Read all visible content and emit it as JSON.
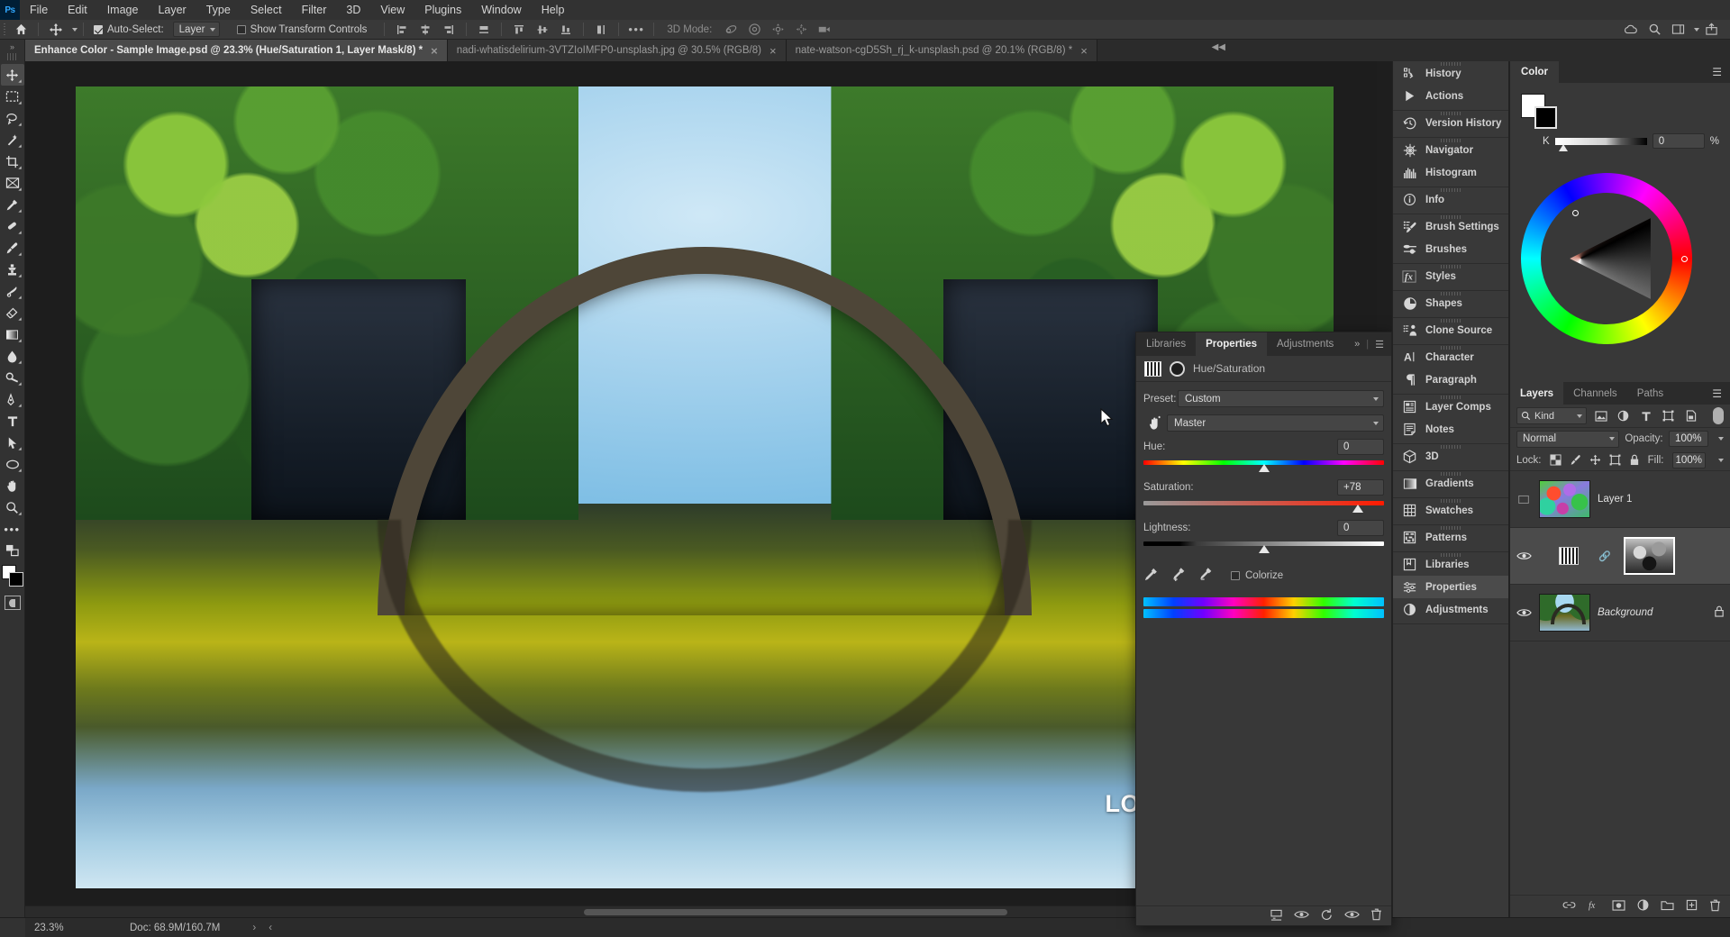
{
  "app": {
    "name": "Adobe Photoshop",
    "logo_text": "Ps",
    "accent": "#31a8ff",
    "panel_bg": "#383838",
    "chrome_bg": "#323232"
  },
  "menubar": {
    "items": [
      "File",
      "Edit",
      "Image",
      "Layer",
      "Type",
      "Select",
      "Filter",
      "3D",
      "View",
      "Plugins",
      "Window",
      "Help"
    ]
  },
  "options_bar": {
    "home_icon": "home-icon",
    "tool_icon": "move-tool-icon",
    "auto_select_label": "Auto-Select:",
    "auto_select_checked": true,
    "auto_select_value": "Layer",
    "show_transform_label": "Show Transform Controls",
    "show_transform_checked": false,
    "align_icons": [
      "align-left-edges-icon",
      "align-horizontal-centers-icon",
      "align-right-edges-icon",
      "distribute-horizontal-icon",
      "align-top-edges-icon",
      "align-vertical-centers-icon",
      "align-bottom-edges-icon",
      "distribute-vertical-icon"
    ],
    "more_label": "•••",
    "mode_3d_label": "3D Mode:",
    "mode_3d_icons": [
      "orbit-3d-icon",
      "roll-3d-icon",
      "pan-3d-icon",
      "slide-3d-icon",
      "camera-3d-icon"
    ],
    "right_icons": [
      "cloud-documents-icon",
      "search-icon",
      "workspace-icon",
      "share-icon"
    ]
  },
  "tabs": [
    {
      "title": "Enhance Color - Sample Image.psd @ 23.3% (Hue/Saturation 1, Layer Mask/8) *",
      "active": true,
      "close": "×"
    },
    {
      "title": "nadi-whatisdelirium-3VTZIoIMFP0-unsplash.jpg @ 30.5% (RGB/8)",
      "active": false,
      "close": "×"
    },
    {
      "title": "nate-watson-cgD5Sh_rj_k-unsplash.psd @ 20.1% (RGB/8) *",
      "active": false,
      "close": "×"
    }
  ],
  "toolbar": {
    "tools": [
      {
        "name": "move-tool",
        "selected": true
      },
      {
        "name": "rectangular-marquee-tool",
        "selected": false
      },
      {
        "name": "lasso-tool",
        "selected": false
      },
      {
        "name": "object-selection-tool",
        "selected": false
      },
      {
        "name": "crop-tool",
        "selected": false
      },
      {
        "name": "frame-tool",
        "selected": false
      },
      {
        "name": "eyedropper-tool",
        "selected": false
      },
      {
        "name": "spot-healing-brush-tool",
        "selected": false
      },
      {
        "name": "brush-tool",
        "selected": false
      },
      {
        "name": "clone-stamp-tool",
        "selected": false
      },
      {
        "name": "history-brush-tool",
        "selected": false
      },
      {
        "name": "eraser-tool",
        "selected": false
      },
      {
        "name": "gradient-tool",
        "selected": false
      },
      {
        "name": "blur-tool",
        "selected": false
      },
      {
        "name": "dodge-tool",
        "selected": false
      },
      {
        "name": "pen-tool",
        "selected": false
      },
      {
        "name": "horizontal-type-tool",
        "selected": false
      },
      {
        "name": "path-selection-tool",
        "selected": false
      },
      {
        "name": "ellipse-tool",
        "selected": false
      },
      {
        "name": "hand-tool",
        "selected": false
      },
      {
        "name": "zoom-tool",
        "selected": false
      },
      {
        "name": "edit-toolbar",
        "selected": false
      }
    ],
    "foreground_color": "#ffffff",
    "background_color": "#000000"
  },
  "canvas": {
    "watermark": "LOGONOMY.IR",
    "image_description": "Rakotzbrucke devil's bridge stone arch over a still lake with reflection, surrounded by green trees"
  },
  "status_bar": {
    "zoom": "23.3%",
    "doc_label": "Doc: 68.9M/160.7M"
  },
  "properties_panel": {
    "tabs": [
      {
        "label": "Libraries",
        "active": false
      },
      {
        "label": "Properties",
        "active": true
      },
      {
        "label": "Adjustments",
        "active": false
      }
    ],
    "overflow": "»",
    "menu_icon": "panel-menu-icon",
    "adjustment_icon": "hue-saturation-adjustment-icon",
    "mask_icon": "layer-mask-icon",
    "title": "Hue/Saturation",
    "preset_label": "Preset:",
    "preset_value": "Custom",
    "channel_value": "Master",
    "targeted_adjustment_icon": "targeted-adjustment-hand-icon",
    "sliders": [
      {
        "label": "Hue:",
        "value": "0",
        "pos_pct": 50
      },
      {
        "label": "Saturation:",
        "value": "+78",
        "pos_pct": 89
      },
      {
        "label": "Lightness:",
        "value": "0",
        "pos_pct": 50
      }
    ],
    "eyedroppers": [
      "eyedropper-icon",
      "eyedropper-add-icon",
      "eyedropper-subtract-icon"
    ],
    "colorize_label": "Colorize",
    "colorize_checked": false,
    "footer_icons": [
      "clip-to-layer-icon",
      "toggle-visibility-icon",
      "reset-icon",
      "preview-eye-icon",
      "delete-icon"
    ]
  },
  "dock": {
    "groups": [
      [
        {
          "label": "History",
          "icon": "history-icon",
          "active": false
        },
        {
          "label": "Actions",
          "icon": "actions-play-icon",
          "active": false
        }
      ],
      [
        {
          "label": "Version History",
          "icon": "version-history-clock-icon",
          "active": false
        }
      ],
      [
        {
          "label": "Navigator",
          "icon": "navigator-icon",
          "active": false
        },
        {
          "label": "Histogram",
          "icon": "histogram-icon",
          "active": false
        }
      ],
      [
        {
          "label": "Info",
          "icon": "info-icon",
          "active": false
        }
      ],
      [
        {
          "label": "Brush Settings",
          "icon": "brush-settings-icon",
          "active": false
        },
        {
          "label": "Brushes",
          "icon": "brushes-icon",
          "active": false
        }
      ],
      [
        {
          "label": "Styles",
          "icon": "styles-fx-icon",
          "active": false
        }
      ],
      [
        {
          "label": "Shapes",
          "icon": "shapes-icon",
          "active": false
        }
      ],
      [
        {
          "label": "Clone Source",
          "icon": "clone-source-icon",
          "active": false
        }
      ],
      [
        {
          "label": "Character",
          "icon": "character-icon",
          "active": false
        },
        {
          "label": "Paragraph",
          "icon": "paragraph-icon",
          "active": false
        }
      ],
      [
        {
          "label": "Layer Comps",
          "icon": "layer-comps-icon",
          "active": false
        },
        {
          "label": "Notes",
          "icon": "notes-icon",
          "active": false
        }
      ],
      [
        {
          "label": "3D",
          "icon": "cube-3d-icon",
          "active": false
        }
      ],
      [
        {
          "label": "Gradients",
          "icon": "gradients-icon",
          "active": false
        }
      ],
      [
        {
          "label": "Swatches",
          "icon": "swatches-grid-icon",
          "active": false
        }
      ],
      [
        {
          "label": "Patterns",
          "icon": "patterns-icon",
          "active": false
        }
      ],
      [
        {
          "label": "Libraries",
          "icon": "libraries-book-icon",
          "active": false
        },
        {
          "label": "Properties",
          "icon": "properties-sliders-icon",
          "active": true
        },
        {
          "label": "Adjustments",
          "icon": "adjustments-half-circle-icon",
          "active": false
        }
      ]
    ]
  },
  "color_panel": {
    "tab_label": "Color",
    "menu_icon": "panel-menu-icon",
    "foreground_color": "#ffffff",
    "background_color": "#000000",
    "channel_label": "K",
    "channel_value": "0",
    "channel_unit": "%",
    "wheel_icon": "color-wheel"
  },
  "layers_panel": {
    "tabs": [
      {
        "label": "Layers",
        "active": true
      },
      {
        "label": "Channels",
        "active": false
      },
      {
        "label": "Paths",
        "active": false
      }
    ],
    "menu_icon": "panel-menu-icon",
    "filter_label": "Kind",
    "filter_icons": [
      "filter-pixel-icon",
      "filter-adjustment-icon",
      "filter-type-icon",
      "filter-shape-icon",
      "filter-smart-object-icon"
    ],
    "blend_mode": "Normal",
    "opacity_label": "Opacity:",
    "opacity_value": "100%",
    "lock_label": "Lock:",
    "lock_icons": [
      "lock-transparent-pixels-icon",
      "lock-image-pixels-icon",
      "lock-position-icon",
      "lock-artboard-icon",
      "lock-all-icon"
    ],
    "fill_label": "Fill:",
    "fill_value": "100%",
    "layers": [
      {
        "name": "Layer 1",
        "visible": false,
        "selected": false,
        "type": "pixel",
        "italic": false,
        "locked": false
      },
      {
        "name": "",
        "visible": true,
        "selected": true,
        "type": "hue-saturation-adjustment",
        "italic": false,
        "locked": false,
        "linked": true,
        "has_mask": true
      },
      {
        "name": "Background",
        "visible": true,
        "selected": false,
        "type": "pixel",
        "italic": true,
        "locked": true
      }
    ],
    "footer_icons": [
      "link-layers-icon",
      "layer-style-fx-icon",
      "add-layer-mask-icon",
      "new-fill-adjustment-layer-icon",
      "new-group-icon",
      "new-layer-icon",
      "delete-layer-icon"
    ]
  }
}
